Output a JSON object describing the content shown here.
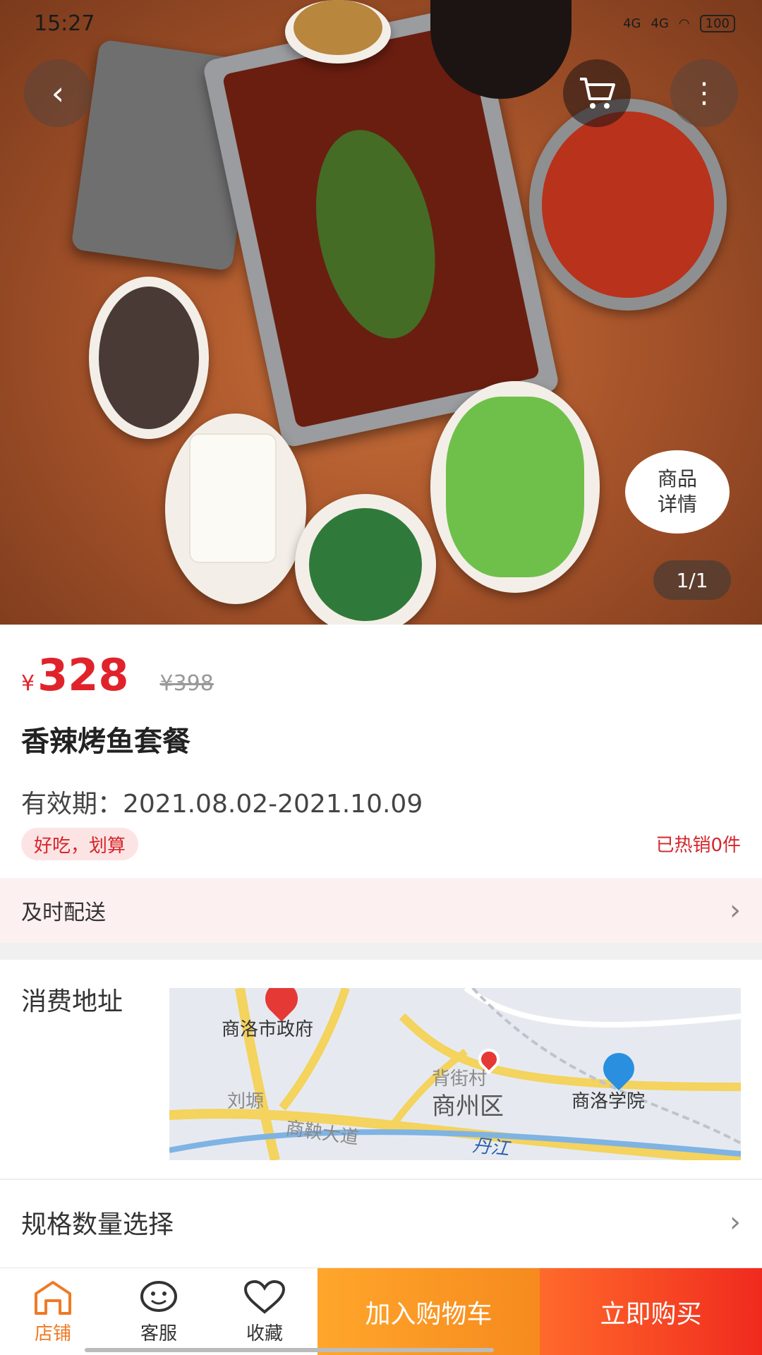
{
  "status_bar": {
    "time": "15:27",
    "network1": "4G",
    "network2": "4G",
    "battery": "100"
  },
  "hero": {
    "pager": "1/1",
    "detail_bubble_line1": "商品",
    "detail_bubble_line2": "详情",
    "icons": {
      "back": "back-arrow-icon",
      "cart": "cart-icon",
      "more": "more-vertical-icon"
    }
  },
  "product": {
    "currency": "¥",
    "price": "328",
    "original_price": "¥398",
    "title": "香辣烤鱼套餐",
    "validity": "有效期：2021.08.02-2021.10.09",
    "tag": "好吃，划算",
    "sold": "已热销0件"
  },
  "delivery": {
    "label": "及时配送"
  },
  "address": {
    "label": "消费地址",
    "map_labels": {
      "govt": "商洛市政府",
      "village": "背街村",
      "district": "商州区",
      "college": "商洛学院",
      "liuyuan": "刘塬",
      "road": "商鞅大道",
      "river": "丹江"
    }
  },
  "spec": {
    "label": "规格数量选择"
  },
  "bottom_bar": {
    "store": "店铺",
    "service": "客服",
    "favorite": "收藏",
    "add_to_cart": "加入购物车",
    "buy_now": "立即购买"
  },
  "colors": {
    "accent_red": "#e0232b",
    "orange": "#f68a1e",
    "buy_red": "#f02a1e"
  }
}
